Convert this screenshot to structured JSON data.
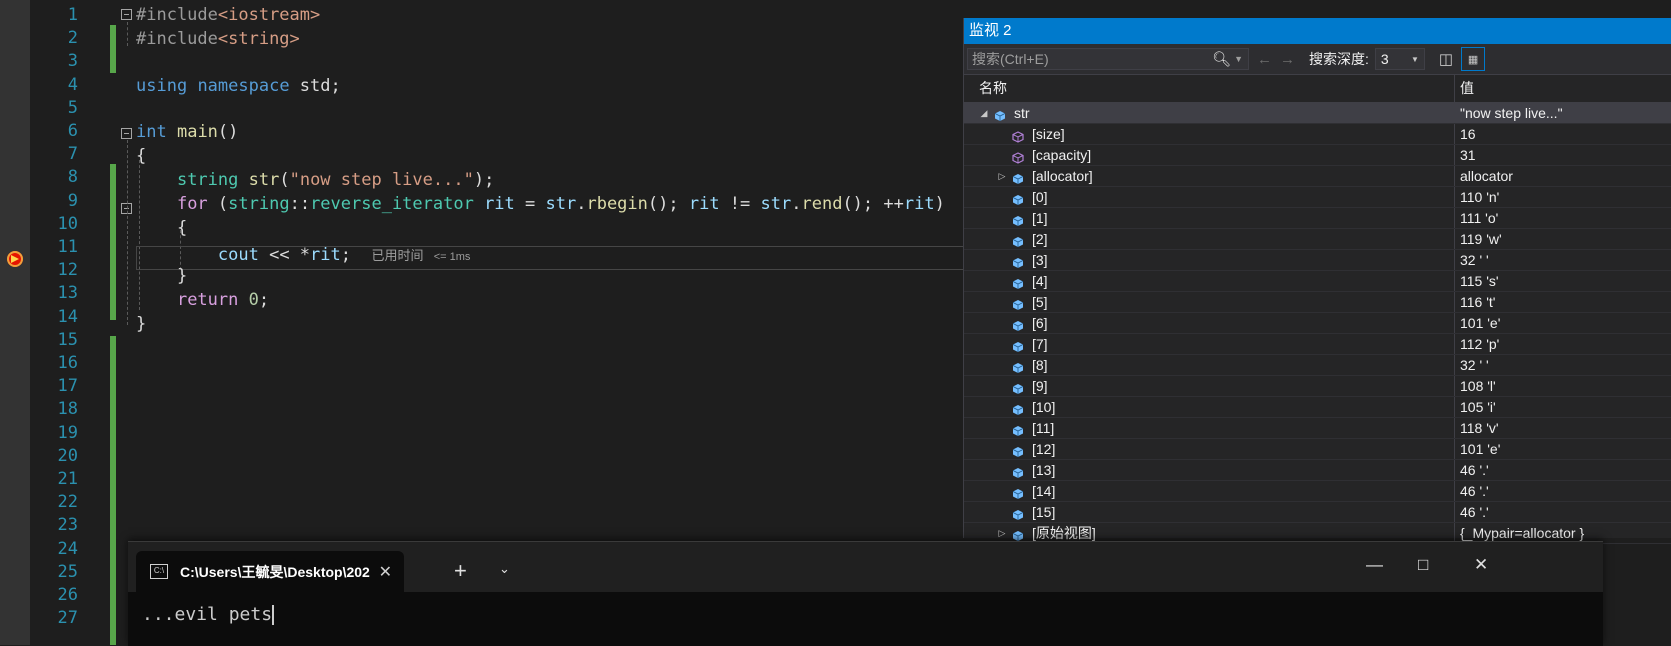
{
  "editor": {
    "line_numbers": [
      "1",
      "2",
      "3",
      "4",
      "5",
      "6",
      "7",
      "8",
      "9",
      "10",
      "11",
      "12",
      "13",
      "14",
      "15",
      "16",
      "17",
      "18",
      "19",
      "20",
      "21",
      "22",
      "23",
      "24",
      "25",
      "26",
      "27"
    ],
    "code": {
      "l1_pp": "#include",
      "l1_inc": "<iostream>",
      "l2_pp": "#include",
      "l2_inc": "<string>",
      "l4_kw1": "using",
      "l4_kw2": "namespace",
      "l4_rest": " std;",
      "l6_kw": "int",
      "l6_fn": "main",
      "l6_rest": "()",
      "l7": "{",
      "l8_ty": "string",
      "l8_fn": "str",
      "l8_p1": "(",
      "l8_st": "\"now step live...\"",
      "l8_p2": ");",
      "l9_kw": "for",
      "l9_p1": " (",
      "l9_ty": "string",
      "l9_p2": "::",
      "l9_ty2": "reverse_iterator",
      "l9_var": " rit",
      "l9_p3": " = ",
      "l9_var2": "str",
      "l9_p4": ".",
      "l9_fn": "rbegin",
      "l9_p5": "(); ",
      "l9_var3": "rit",
      "l9_p6": " != ",
      "l9_var4": "str",
      "l9_p7": ".",
      "l9_fn2": "rend",
      "l9_p8": "(); ++",
      "l9_var5": "rit",
      "l9_p9": ")",
      "l10": "{",
      "l11_var": "cout",
      "l11_op": " << *",
      "l11_var2": "rit",
      "l11_end": ";",
      "l11_elapsed_label": "已用时间",
      "l11_elapsed_value": "<= 1ms",
      "l12": "}",
      "l13_kw": "return",
      "l13_num": " 0",
      "l13_end": ";",
      "l14": "}"
    }
  },
  "watch": {
    "title": "监视 2",
    "search_placeholder": "搜索(Ctrl+E)",
    "search_depth_label": "搜索深度:",
    "search_depth_value": "3",
    "col_name": "名称",
    "col_value": "值",
    "rows": [
      {
        "name": "str",
        "value": "\"now step live...\""
      },
      {
        "name": "[size]",
        "value": "16"
      },
      {
        "name": "[capacity]",
        "value": "31"
      },
      {
        "name": "[allocator]",
        "value": "allocator"
      },
      {
        "name": "[0]",
        "value": "110 'n'"
      },
      {
        "name": "[1]",
        "value": "111 'o'"
      },
      {
        "name": "[2]",
        "value": "119 'w'"
      },
      {
        "name": "[3]",
        "value": "32 ' '"
      },
      {
        "name": "[4]",
        "value": "115 's'"
      },
      {
        "name": "[5]",
        "value": "116 't'"
      },
      {
        "name": "[6]",
        "value": "101 'e'"
      },
      {
        "name": "[7]",
        "value": "112 'p'"
      },
      {
        "name": "[8]",
        "value": "32 ' '"
      },
      {
        "name": "[9]",
        "value": "108 'l'"
      },
      {
        "name": "[10]",
        "value": "105 'i'"
      },
      {
        "name": "[11]",
        "value": "118 'v'"
      },
      {
        "name": "[12]",
        "value": "101 'e'"
      },
      {
        "name": "[13]",
        "value": "46 '.'"
      },
      {
        "name": "[14]",
        "value": "46 '.'"
      },
      {
        "name": "[15]",
        "value": "46 '.'"
      },
      {
        "name": "[原始视图]",
        "value": "{_Mypair=allocator }"
      }
    ]
  },
  "terminal": {
    "tab_title": "C:\\Users\\王毓旻\\Desktop\\202",
    "output": "...evil pets"
  }
}
